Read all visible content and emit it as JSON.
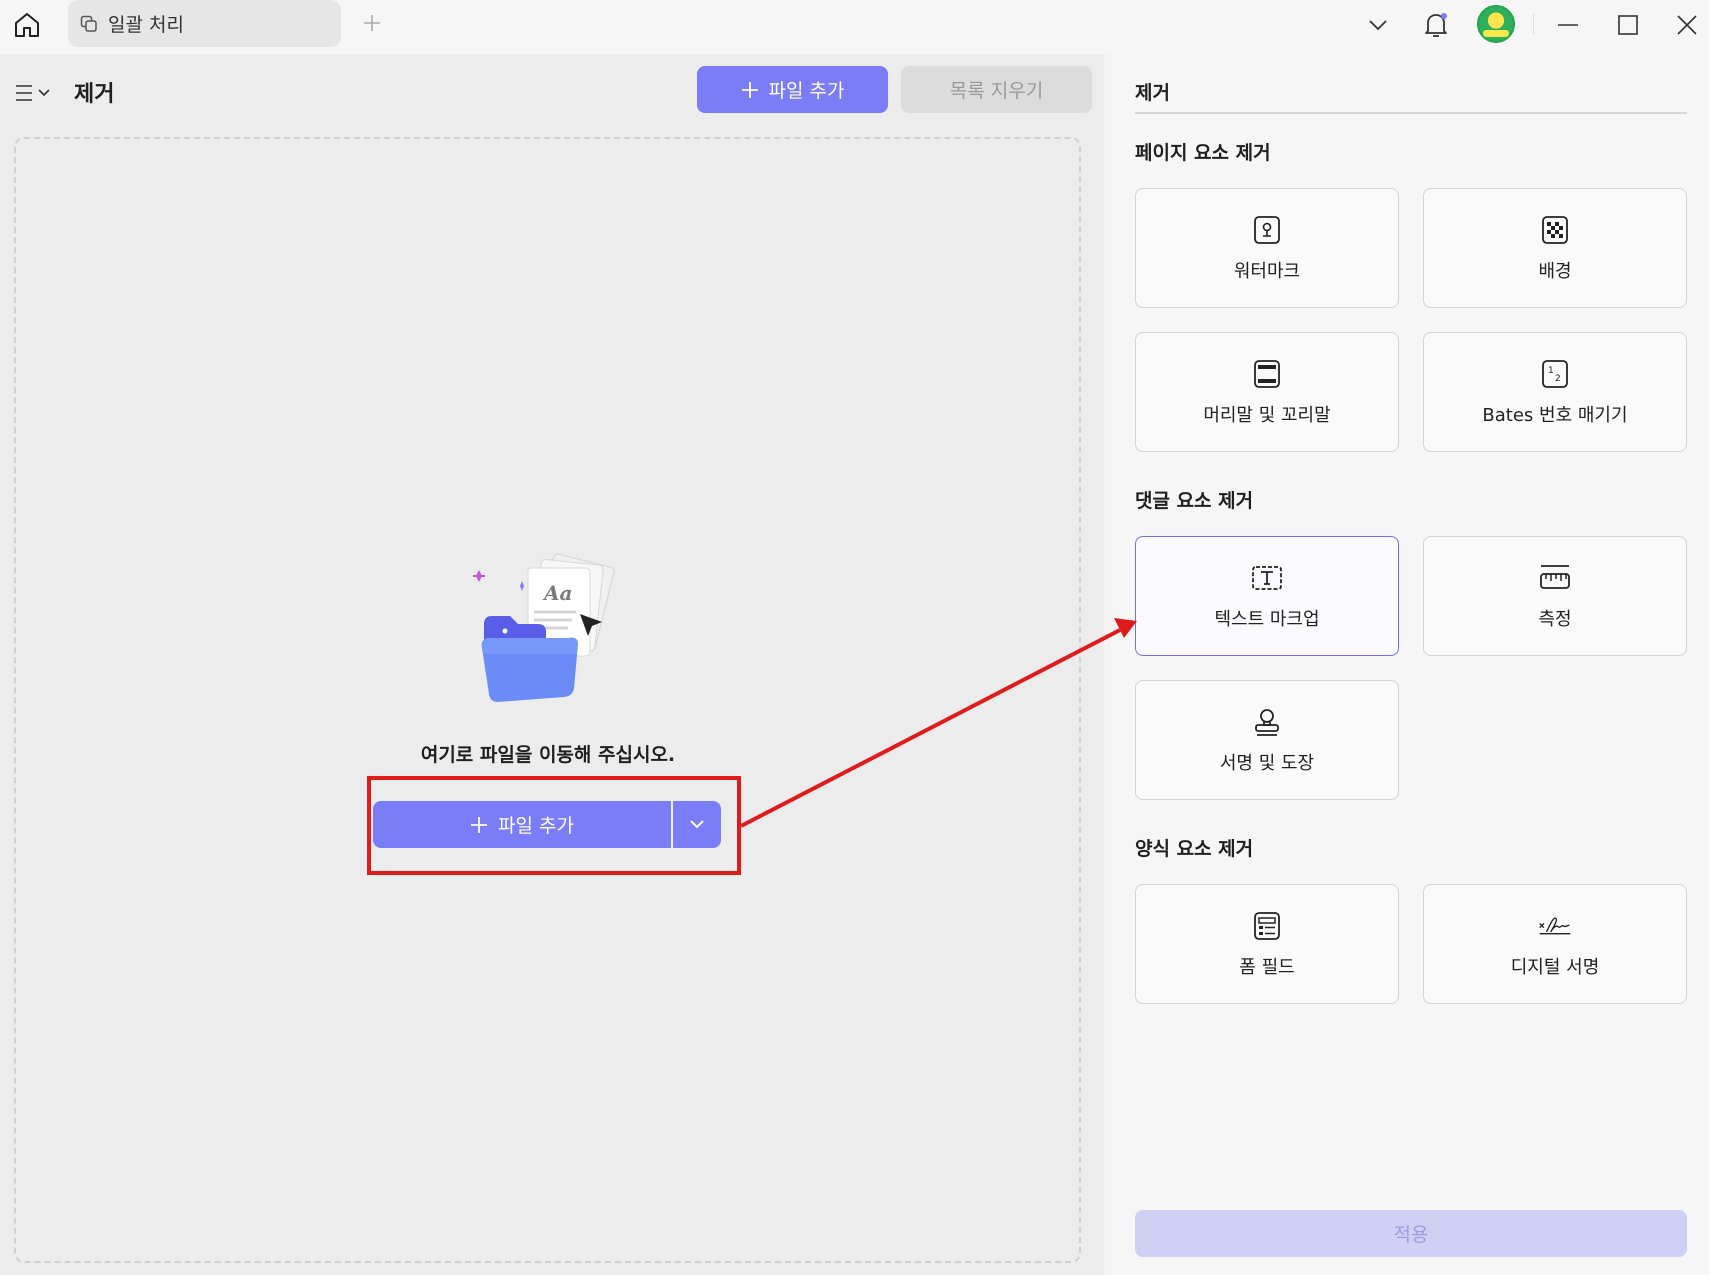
{
  "titlebar": {
    "tab_label": "일괄 처리"
  },
  "main": {
    "title": "제거",
    "add_file_label": "파일 추가",
    "clear_list_label": "목록 지우기",
    "drop_text": "여기로 파일을 이동해 주십시오.",
    "add_file_center_label": "파일 추가",
    "illustration_text": "Aa"
  },
  "panel": {
    "title": "제거",
    "sections": [
      {
        "heading": "페이지 요소 제거",
        "items": [
          {
            "label": "워터마크",
            "icon": "watermark-icon"
          },
          {
            "label": "배경",
            "icon": "background-icon"
          },
          {
            "label": "머리말 및 꼬리말",
            "icon": "header-footer-icon"
          },
          {
            "label": "Bates 번호 매기기",
            "icon": "bates-number-icon"
          }
        ]
      },
      {
        "heading": "댓글 요소 제거",
        "items": [
          {
            "label": "텍스트 마크업",
            "icon": "text-markup-icon",
            "selected": true
          },
          {
            "label": "측정",
            "icon": "measure-icon"
          },
          {
            "label": "서명 및 도장",
            "icon": "stamp-icon"
          }
        ]
      },
      {
        "heading": "양식 요소 제거",
        "items": [
          {
            "label": "폼 필드",
            "icon": "form-field-icon"
          },
          {
            "label": "디지털 서명",
            "icon": "digital-signature-icon"
          }
        ]
      }
    ],
    "bates_superscript": "1",
    "bates_subscript": "2",
    "apply_label": "적용"
  },
  "colors": {
    "accent": "#7b7df6",
    "highlight": "#e01b1b",
    "selected_border": "#6d6ff0",
    "apply_disabled": "#cfd0f4"
  }
}
